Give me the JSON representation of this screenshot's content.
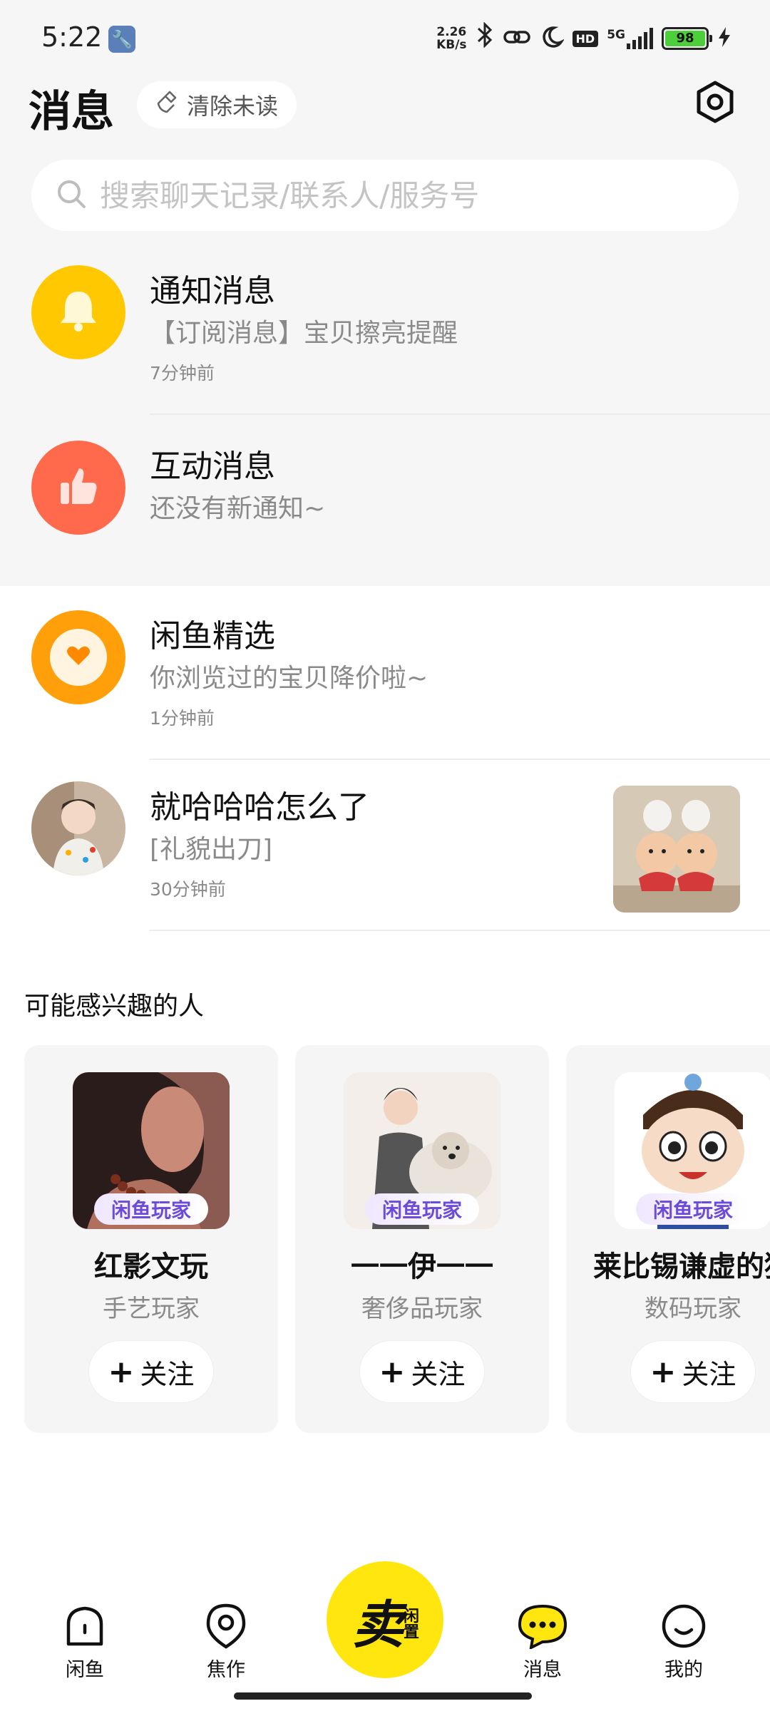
{
  "status": {
    "time": "5:22",
    "net_speed_value": "2.26",
    "net_speed_unit": "KB/s",
    "hd": "HD",
    "network": "5G",
    "battery": "98"
  },
  "header": {
    "title": "消息",
    "clear_unread": "清除未读"
  },
  "search": {
    "placeholder": "搜索聊天记录/联系人/服务号"
  },
  "messages": [
    {
      "name": "通知消息",
      "text": "【订阅消息】宝贝擦亮提醒",
      "time": "7分钟前"
    },
    {
      "name": "互动消息",
      "text": "还没有新通知~",
      "time": ""
    },
    {
      "name": "闲鱼精选",
      "text": "你浏览过的宝贝降价啦~",
      "time": "1分钟前"
    },
    {
      "name": "就哈哈哈怎么了",
      "text": "[礼貌出刀]",
      "time": "30分钟前"
    }
  ],
  "suggest": {
    "title": "可能感兴趣的人",
    "badge": "闲鱼玩家",
    "follow_label": "关注",
    "cards": [
      {
        "name": "红影文玩",
        "role": "手艺玩家"
      },
      {
        "name": "一一伊一一",
        "role": "奢侈品玩家"
      },
      {
        "name": "莱比锡谦虚的猪",
        "role": "数码玩家"
      }
    ]
  },
  "nav": {
    "home": "闲鱼",
    "focus": "焦作",
    "sell_main": "卖",
    "sell_sub": "闲置",
    "messages": "消息",
    "mine": "我的"
  },
  "colors": {
    "brand_yellow": "#ffe60f",
    "notify_yellow": "#ffc800",
    "interact_red": "#ff6a4d",
    "select_orange": "#ff9f0a",
    "badge_purple": "#6b4bd8"
  }
}
